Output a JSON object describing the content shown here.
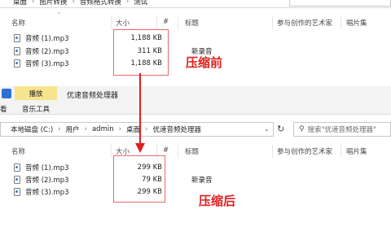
{
  "top": {
    "breadcrumb": [
      "桌面",
      "图片转换",
      "音频格式转换",
      "测试"
    ],
    "columns": {
      "name": "名称",
      "size": "大小",
      "hash": "#",
      "title": "标题",
      "artist": "参与创作的艺术家",
      "album": "唱片集"
    },
    "files": [
      {
        "name": "音频 (1).mp3",
        "size": "1,188 KB",
        "title": ""
      },
      {
        "name": "音频 (2).mp3",
        "size": "311 KB",
        "title": "新录音"
      },
      {
        "name": "音频 (3).mp3",
        "size": "1,188 KB",
        "title": ""
      }
    ],
    "annotation": "压缩前"
  },
  "ribbon": {
    "tab_play": "播放",
    "window_title": "优速音频处理器",
    "tab_music_tools": "音乐工具",
    "left_cut": "看"
  },
  "bottom": {
    "breadcrumb": [
      "本地磁盘 (C:)",
      "用户",
      "admin",
      "桌面",
      "优速音频处理器"
    ],
    "search_placeholder": "搜索\"优速音频处理器\"",
    "columns": {
      "name": "名称",
      "size": "大小",
      "hash": "#",
      "title": "标题",
      "artist": "参与创作的艺术家",
      "album": "唱片集"
    },
    "files": [
      {
        "name": "音频 (1).mp3",
        "size": "299 KB",
        "title": ""
      },
      {
        "name": "音频 (2).mp3",
        "size": "79 KB",
        "title": "新录音"
      },
      {
        "name": "音频 (3).mp3",
        "size": "299 KB",
        "title": ""
      }
    ],
    "annotation": "压缩后"
  },
  "colors": {
    "annotation": "#e02020",
    "ribbon_highlight": "#f6e48f"
  },
  "icons": [
    "file-audio-icon",
    "chevron-down-icon",
    "refresh-icon",
    "search-icon",
    "music-app-icon",
    "sort-up-icon"
  ]
}
